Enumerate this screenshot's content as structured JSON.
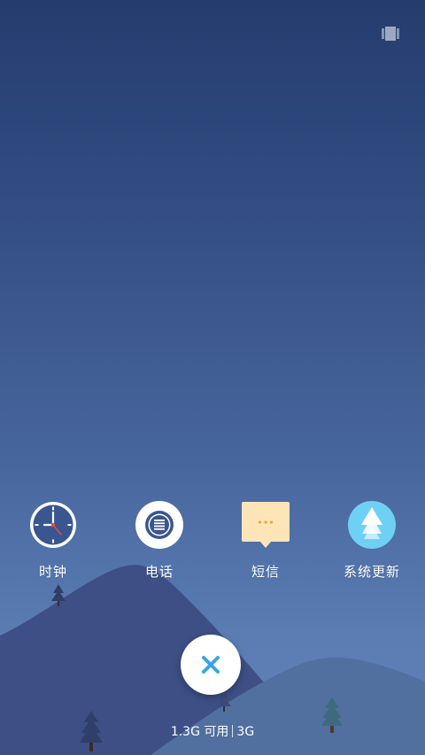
{
  "status_icon": "recents-view-icon",
  "apps": [
    {
      "label": "时钟",
      "icon": "clock-icon"
    },
    {
      "label": "电话",
      "icon": "phone-icon"
    },
    {
      "label": "短信",
      "icon": "message-icon"
    },
    {
      "label": "系统更新",
      "icon": "system-update-icon"
    }
  ],
  "close_button": {
    "icon": "close-icon"
  },
  "memory": {
    "available": "1.3G 可用",
    "total": "3G"
  },
  "colors": {
    "accent": "#3aa3e8",
    "background_top": "#253c6e",
    "background_bottom": "#6283b8"
  }
}
